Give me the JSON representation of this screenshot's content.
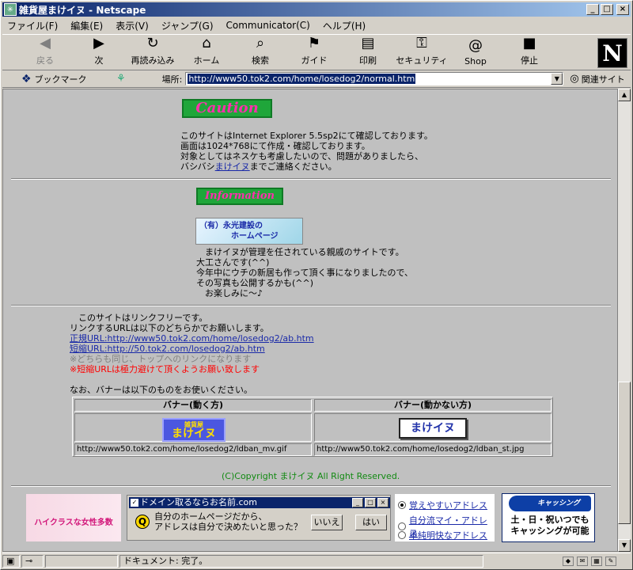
{
  "window": {
    "title": "雑貨屋まけイヌ - Netscape",
    "min": "_",
    "max": "□",
    "close": "×"
  },
  "menu": [
    "ファイル(F)",
    "編集(E)",
    "表示(V)",
    "ジャンプ(G)",
    "Communicator(C)",
    "ヘルプ(H)"
  ],
  "toolbar": [
    {
      "label": "戻る",
      "icon": "back-arrow",
      "glyph": "◀"
    },
    {
      "label": "次",
      "icon": "forward-arrow",
      "glyph": "▶"
    },
    {
      "label": "再読み込み",
      "icon": "reload",
      "glyph": "↻"
    },
    {
      "label": "ホーム",
      "icon": "home",
      "glyph": "⌂"
    },
    {
      "label": "検索",
      "icon": "search",
      "glyph": "⌕"
    },
    {
      "label": "ガイド",
      "icon": "guide",
      "glyph": "⚑"
    },
    {
      "label": "印刷",
      "icon": "print",
      "glyph": "▤"
    },
    {
      "label": "セキュリティ",
      "icon": "lock",
      "glyph": "⚿"
    },
    {
      "label": "Shop",
      "icon": "shop",
      "glyph": "@"
    },
    {
      "label": "停止",
      "icon": "stop",
      "glyph": "■"
    }
  ],
  "brand": "N",
  "location": {
    "bookmark": "ブックマーク",
    "label": "場所:",
    "url": "http://www50.tok2.com/home/losedog2/normal.htm",
    "related": "関連サイト"
  },
  "caution": {
    "banner": "Caution",
    "lines": [
      "このサイトはInternet Explorer 5.5sp2にて確認しております。",
      "画面は1024*768にて作成・確認しております。",
      "対象としてはネスケも考慮したいので、問題がありましたら、"
    ],
    "line4_pre": "バシバシ",
    "line4_link": "まけイヌ",
    "line4_post": "までご連絡ください。"
  },
  "information": {
    "banner": "Information",
    "eiko_line1": "（有）永光建設の",
    "eiko_line2": "ホームページ",
    "lines": [
      "　まけイヌが管理を任されている親戚のサイトです。",
      "大工さんです(^^)",
      "今年中にウチの新居も作って頂く事になりましたので、",
      "その写真も公開するかも(^^)",
      "　お楽しみに～♪"
    ]
  },
  "linkfree": {
    "line1": "　このサイトはリンクフリーです。",
    "line2": "リンクするURLは以下のどちらかでお願いします。",
    "official_label": "正規URL:",
    "official_url": "http://www50.tok2.com/home/losedog2/ab.htm",
    "short_label": "短縮URL:",
    "short_url": "http://50.tok2.com/losedog2/ab.htm",
    "note_gray": "※どちらも同じ、トップへのリンクになります",
    "note_red": "※短縮URLは極力避けて頂くようお願い致します",
    "banner_intro": "なお、バナーは以下のものをお使いください。"
  },
  "banners": {
    "h1": "バナー(動く方)",
    "h2": "バナー(動かない方)",
    "anim_sub": "雑貨屋",
    "anim_main": "まけイヌ",
    "static_main": "まけイヌ",
    "url1": "http://www50.tok2.com/home/losedog2/ldban_mv.gif",
    "url2": "http://www50.tok2.com/home/losedog2/ldban_st.jpg"
  },
  "copyright": "(C)Copyright まけイヌ All Right Reserved.",
  "ads": {
    "ad1": "ハイクラスな女性多数",
    "domain_title": "ドメイン取るならお名前.com",
    "q_line1": "自分のホームページだから、",
    "q_line2": "アドレスは自分で決めたいと思った？",
    "no": "いいえ",
    "yes": "はい",
    "opts": [
      "覚えやすいアドレス",
      "自分流マイ・アドレス",
      "単純明快なアドレス"
    ],
    "cash_logo": "キャッシング",
    "cash_line1": "土・日・祝いつでも",
    "cash_line2": "キャッシングが可能"
  },
  "status": {
    "text": "ドキュメント: 完了。"
  }
}
